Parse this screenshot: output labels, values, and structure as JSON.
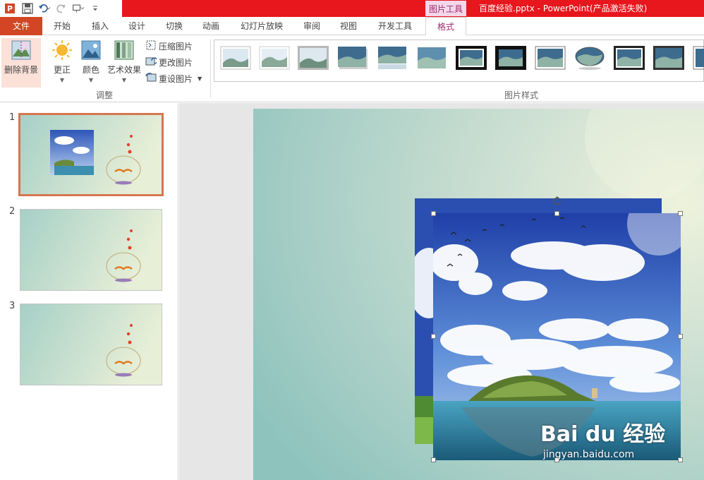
{
  "titlebar": {
    "context_group": "图片工具",
    "document_title": "百度经验.pptx - PowerPoint(产品激活失败)"
  },
  "tabs": [
    {
      "label": "文件"
    },
    {
      "label": "开始"
    },
    {
      "label": "插入"
    },
    {
      "label": "设计"
    },
    {
      "label": "切换"
    },
    {
      "label": "动画"
    },
    {
      "label": "幻灯片放映"
    },
    {
      "label": "审阅"
    },
    {
      "label": "视图"
    },
    {
      "label": "开发工具"
    },
    {
      "label": "格式"
    }
  ],
  "ribbon": {
    "remove_background": "删除背景",
    "corrections": "更正",
    "color": "颜色",
    "artistic_effects": "艺术效果",
    "compress_pictures": "压缩图片",
    "change_picture": "更改图片",
    "reset_picture": "重设图片",
    "adjust_group": "调整",
    "picture_styles_group": "图片样式"
  },
  "slides": [
    {
      "number": "1",
      "selected": true
    },
    {
      "number": "2",
      "selected": false
    },
    {
      "number": "3",
      "selected": false
    }
  ],
  "watermark": {
    "brand": "Bai du 经验",
    "url": "jingyan.baidu.com"
  },
  "colors": {
    "titlebar_red": "#e8161d",
    "file_tab": "#d24625",
    "format_tab_text": "#9c2b6f",
    "slide_selection": "#d6764f"
  }
}
